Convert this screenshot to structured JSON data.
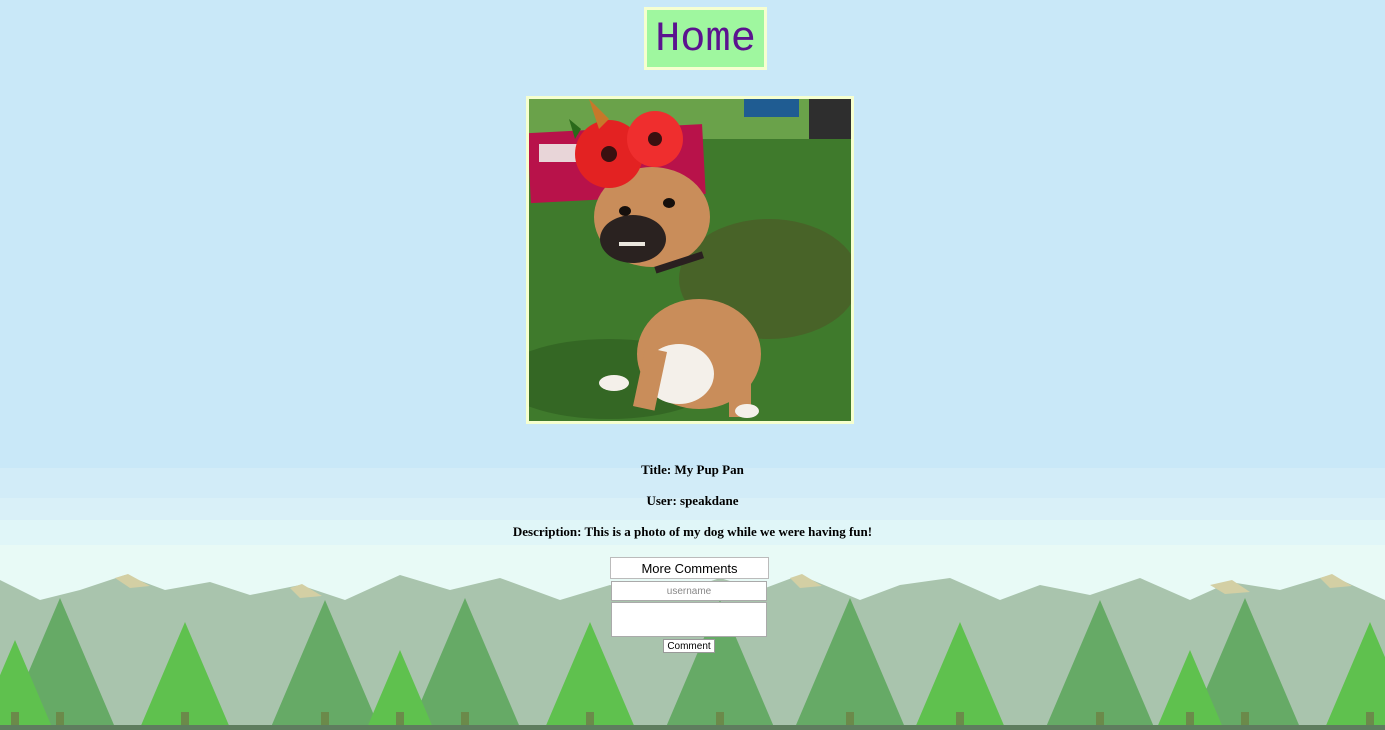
{
  "nav": {
    "home_label": "Home"
  },
  "post": {
    "image_alt": "Pug mix dog wearing a red poppy flower crown sitting on grass",
    "title": "Title: My Pup Pan",
    "user": "User: speakdane",
    "description": "Description: This is a photo of my dog while we were having fun!"
  },
  "comments": {
    "more_label": "More Comments",
    "username_placeholder": "username",
    "comment_value": "",
    "submit_label": "Comment"
  },
  "colors": {
    "sky": "#c9e8f8",
    "home_bg": "#9ff79f",
    "home_text": "#5b138f",
    "frame": "#f6ffd0",
    "tree_dark": "#66aa66",
    "tree_light": "#5fc14e",
    "mountain": "#a9c4ad"
  }
}
